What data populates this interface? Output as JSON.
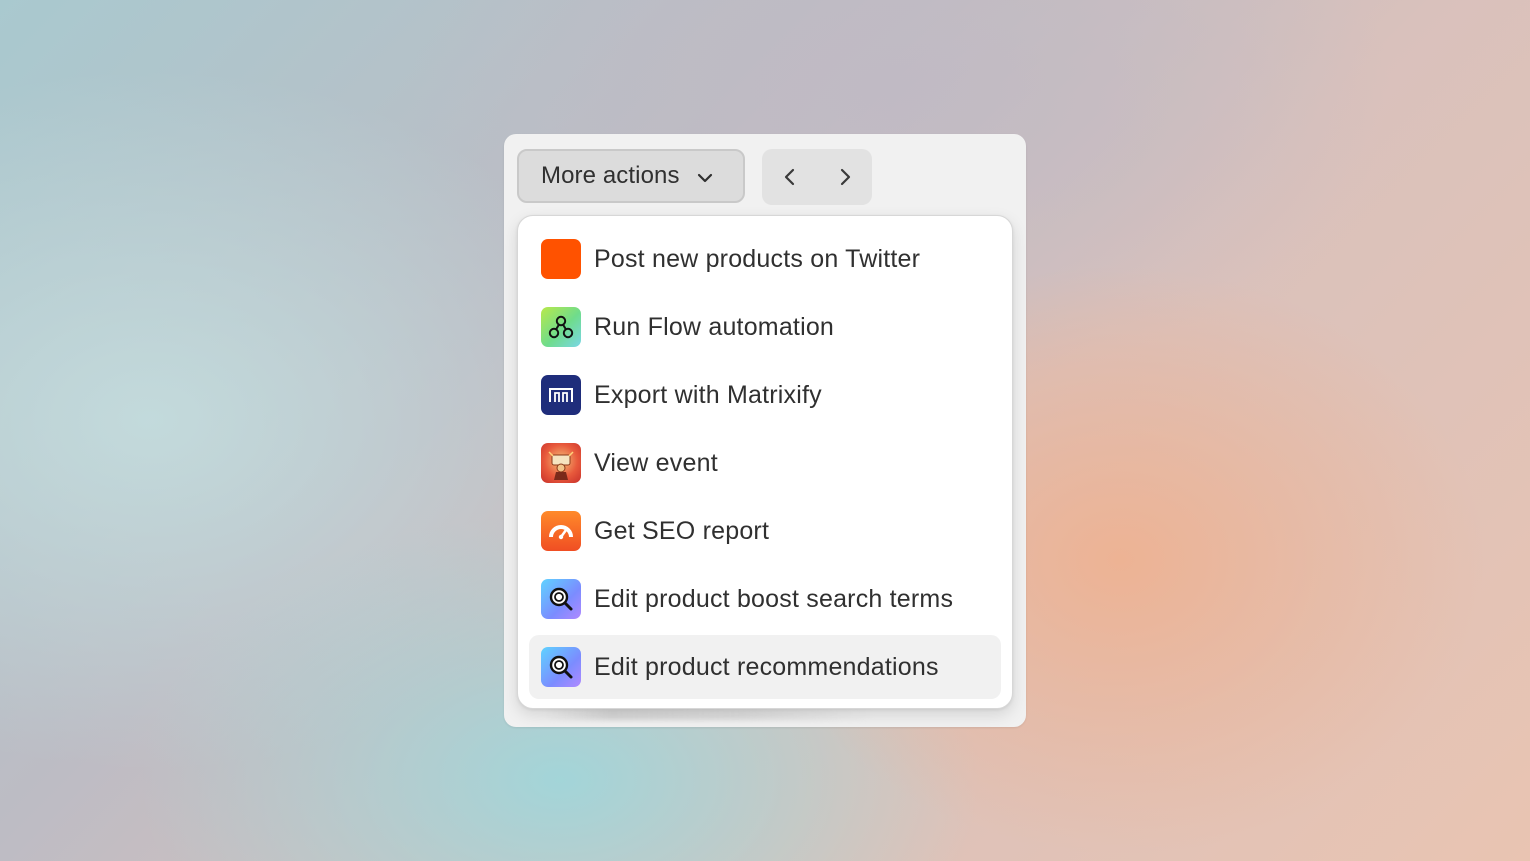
{
  "toolbar": {
    "more_actions_label": "More actions",
    "dropdown_icon": "chevron-down-icon",
    "prev_icon": "chevron-left-icon",
    "next_icon": "chevron-right-icon"
  },
  "menu": {
    "items": [
      {
        "label": "Post new products on Twitter",
        "icon": "orange-square-app-icon",
        "color": "#ff5200"
      },
      {
        "label": "Run Flow automation",
        "icon": "flow-app-icon",
        "color": "#8fe07a"
      },
      {
        "label": "Export with Matrixify",
        "icon": "matrixify-app-icon",
        "color": "#1f2d7b"
      },
      {
        "label": "View event",
        "icon": "event-app-icon",
        "color": "#e0483a"
      },
      {
        "label": "Get SEO report",
        "icon": "seo-gauge-app-icon",
        "color": "#f26522"
      },
      {
        "label": "Edit product boost search terms",
        "icon": "search-app-icon",
        "color": "#6aa8ff"
      },
      {
        "label": "Edit product recommendations",
        "icon": "search-app-icon",
        "color": "#6aa8ff"
      }
    ],
    "highlighted_index": 6
  },
  "colors": {
    "text": "#303030",
    "card_bg": "#f1f1f1",
    "menu_bg": "#ffffff",
    "hover_bg": "#f1f1f1"
  }
}
